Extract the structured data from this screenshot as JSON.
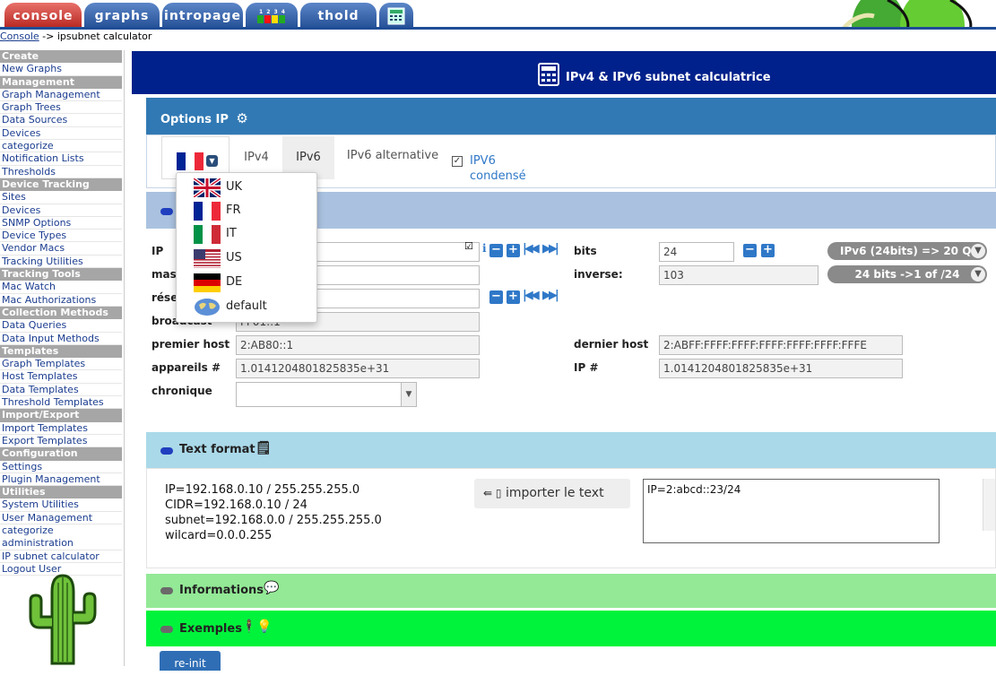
{
  "tabs": [
    {
      "label": "console"
    },
    {
      "label": "graphs"
    },
    {
      "label": "intropage"
    },
    {
      "label": "thold"
    }
  ],
  "breadcrumb": {
    "link": "Console",
    "sep": " -> ",
    "current": "ipsubnet calculator"
  },
  "sidebar": [
    {
      "h": "Create"
    },
    {
      "i": "New Graphs"
    },
    {
      "h": "Management"
    },
    {
      "i": "Graph Management"
    },
    {
      "i": "Graph Trees"
    },
    {
      "i": "Data Sources"
    },
    {
      "i": "Devices"
    },
    {
      "i": "categorize"
    },
    {
      "i": "Notification Lists"
    },
    {
      "i": "Thresholds"
    },
    {
      "h": "Device Tracking"
    },
    {
      "i": "Sites"
    },
    {
      "i": "Devices"
    },
    {
      "i": "SNMP Options"
    },
    {
      "i": "Device Types"
    },
    {
      "i": "Vendor Macs"
    },
    {
      "i": "Tracking Utilities"
    },
    {
      "h": "Tracking Tools"
    },
    {
      "i": "Mac Watch"
    },
    {
      "i": "Mac Authorizations"
    },
    {
      "h": "Collection Methods"
    },
    {
      "i": "Data Queries"
    },
    {
      "i": "Data Input Methods"
    },
    {
      "h": "Templates"
    },
    {
      "i": "Graph Templates"
    },
    {
      "i": "Host Templates"
    },
    {
      "i": "Data Templates"
    },
    {
      "i": "Threshold Templates"
    },
    {
      "h": "Import/Export"
    },
    {
      "i": "Import Templates"
    },
    {
      "i": "Export Templates"
    },
    {
      "h": "Configuration"
    },
    {
      "i": "Settings"
    },
    {
      "i": "Plugin Management"
    },
    {
      "h": "Utilities"
    },
    {
      "i": "System Utilities"
    },
    {
      "i": "User Management"
    },
    {
      "i": "categorize administration"
    },
    {
      "i": "IP subnet calculator"
    },
    {
      "i": "Logout User"
    }
  ],
  "header": {
    "title": "IPv4 & IPv6 subnet calculatrice"
  },
  "options": {
    "title": "Options IP",
    "tab_ipv4": "IPv4",
    "tab_ipv6": "IPv6",
    "tab_alt": "IPv6 alternative",
    "condensed_label": "IPV6 condensé"
  },
  "languages": [
    {
      "code": "UK"
    },
    {
      "code": "FR"
    },
    {
      "code": "IT"
    },
    {
      "code": "US"
    },
    {
      "code": "DE"
    },
    {
      "code": "default"
    }
  ],
  "calc": {
    "ip_label": "IP",
    "mask_label": "mas",
    "network_label": "rése",
    "broadcast_label": "broadcast",
    "broadcast_value": "FF01::1",
    "first_host_label": "premier host",
    "first_host_value": "2:AB80::1",
    "devices_label": "appareils #",
    "devices_value": "1.0141204801825835e+31",
    "chronic_label": "chronique",
    "bits_label": "bits",
    "bits_value": "24",
    "inverse_label": "inverse:",
    "inverse_value": "103",
    "last_host_label": "dernier host",
    "last_host_value": "2:ABFF:FFFF:FFFF:FFFF:FFFF:FFFF:FFFE",
    "ipcount_label": "IP #",
    "ipcount_value": "1.0141204801825835e+31",
    "pill1": "IPv6 (24bits) => 20 Q",
    "pill2": "24 bits ->1 of /24"
  },
  "textformat": {
    "title": "Text format",
    "lines": [
      "IP=192.168.0.10 / 255.255.255.0",
      "CIDR=192.168.0.10 / 24",
      "subnet=192.168.0.0 / 255.255.255.0",
      "wilcard=0.0.0.255"
    ],
    "import_button": "importer le text",
    "textarea_value": "IP=2:abcd::23/24"
  },
  "info": {
    "title": "Informations"
  },
  "examples": {
    "title": "Exemples"
  },
  "reinit": {
    "label": "re-init"
  }
}
